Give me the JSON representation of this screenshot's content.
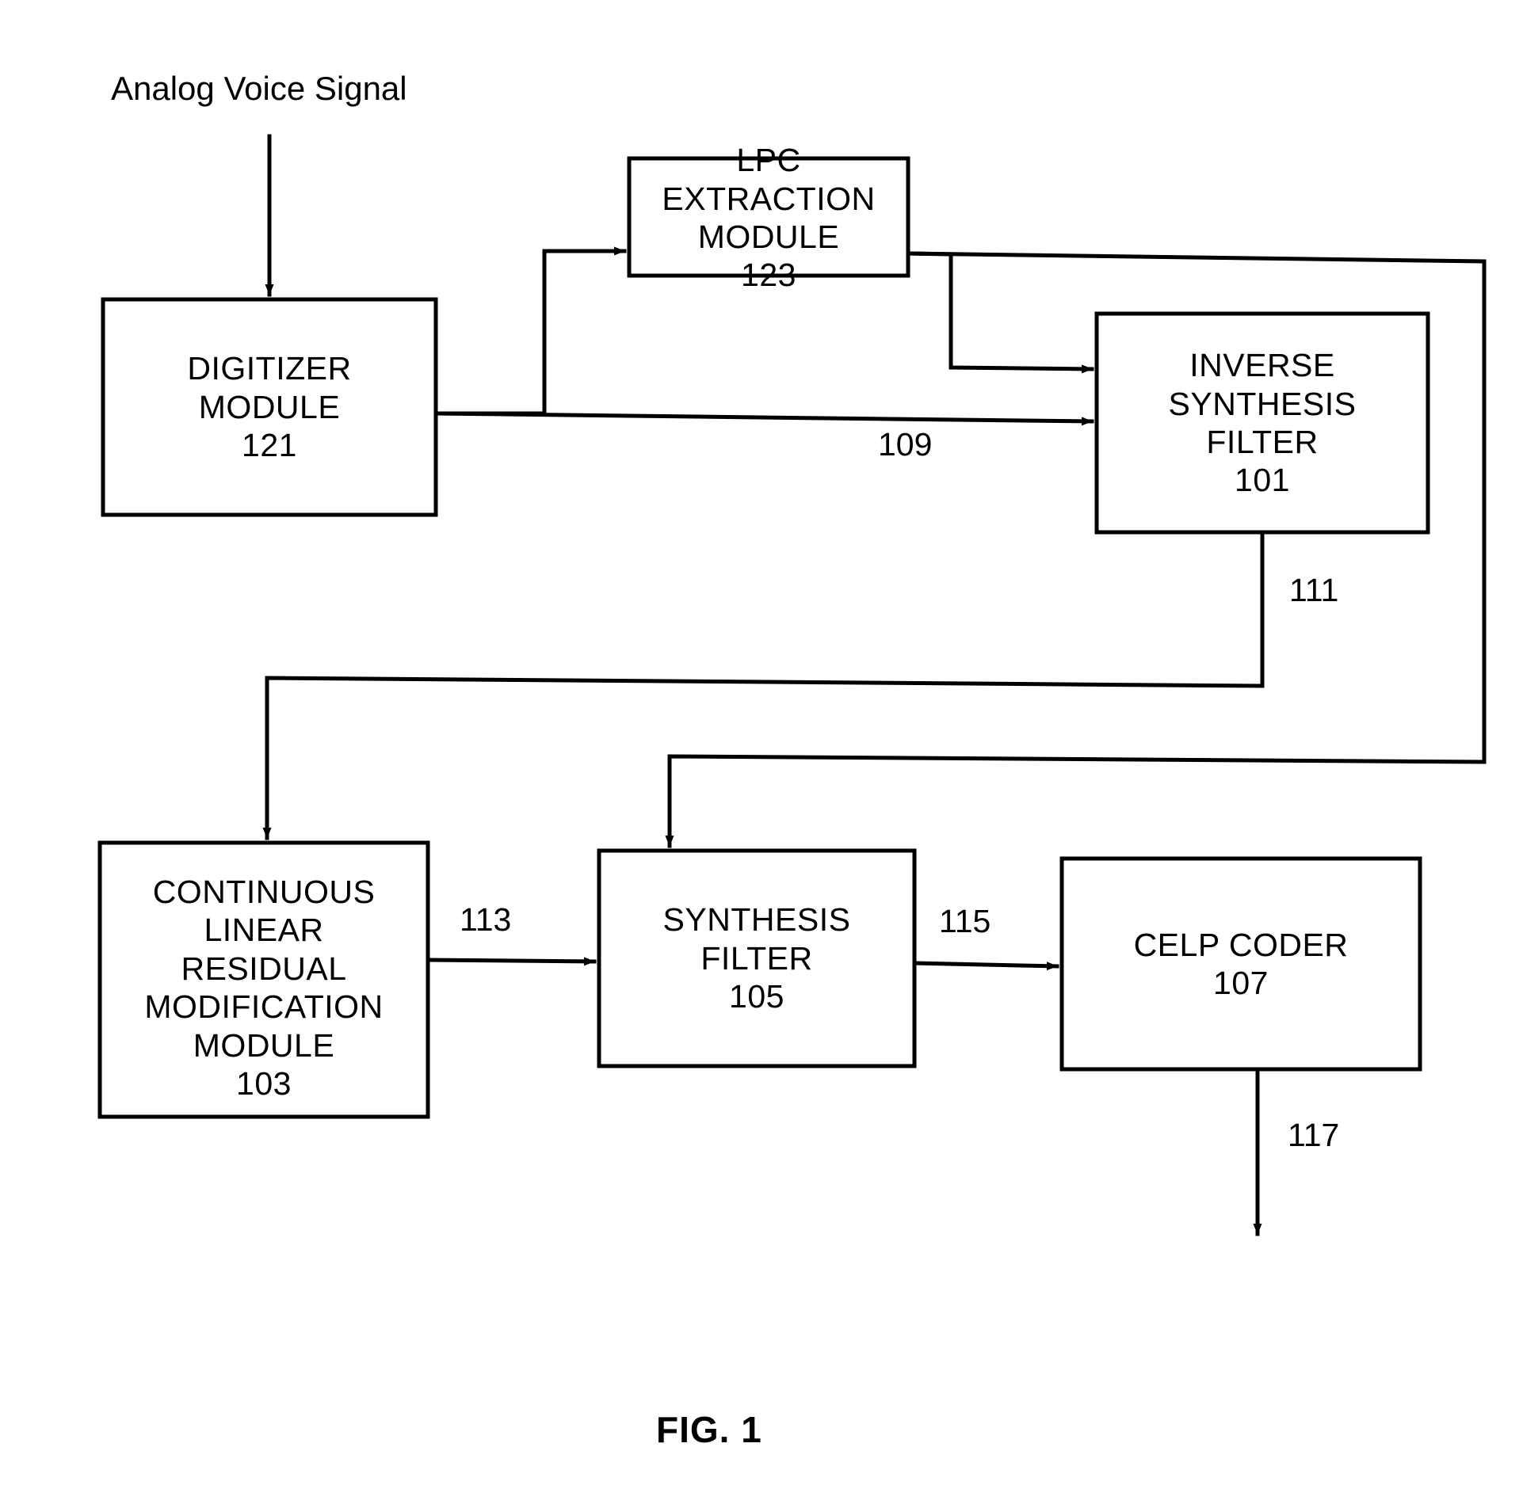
{
  "figure": {
    "caption": "FIG. 1",
    "input_label": "Analog Voice Signal"
  },
  "boxes": [
    {
      "id": "digitizer-module",
      "lines": [
        "DIGITIZER",
        "MODULE"
      ],
      "line1": "DIGITIZER",
      "line2": "MODULE",
      "ref": "121"
    },
    {
      "id": "lpc-extraction-module",
      "lines": [
        "LPC",
        "EXTRACTION",
        "MODULE"
      ],
      "line1": "LPC",
      "line2": "EXTRACTION",
      "line3": "MODULE",
      "ref": "123"
    },
    {
      "id": "inverse-synthesis-filter",
      "lines": [
        "INVERSE",
        "SYNTHESIS",
        "FILTER"
      ],
      "line1": "INVERSE",
      "line2": "SYNTHESIS",
      "line3": "FILTER",
      "ref": "101"
    },
    {
      "id": "continuous-linear-residual-modification-module",
      "lines": [
        "CONTINUOUS",
        "LINEAR",
        "RESIDUAL",
        "MODIFICATION",
        "MODULE"
      ],
      "line1": "CONTINUOUS",
      "line2": "LINEAR",
      "line3": "RESIDUAL",
      "line4": "MODIFICATION",
      "line5": "MODULE",
      "ref": "103"
    },
    {
      "id": "synthesis-filter",
      "lines": [
        "SYNTHESIS",
        "FILTER"
      ],
      "line1": "SYNTHESIS",
      "line2": "FILTER",
      "ref": "105"
    },
    {
      "id": "celp-coder",
      "lines": [
        "CELP CODER"
      ],
      "line1": "CELP CODER",
      "ref": "107"
    }
  ],
  "signals": {
    "digitized_voice": "109",
    "lpc_residual": "111",
    "modified_residual": "113",
    "synthesized_signal": "115",
    "coded_output": "117"
  },
  "colors": {
    "ink": "#000000",
    "paper": "#ffffff"
  }
}
